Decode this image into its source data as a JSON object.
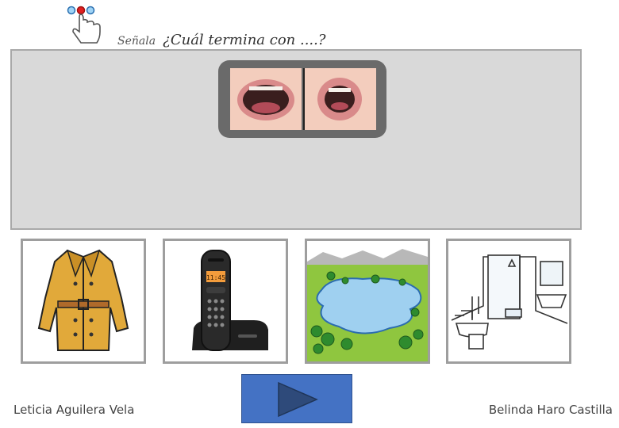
{
  "instruction": {
    "senala": "Señala",
    "question": "¿Cuál termina con ....?"
  },
  "stage": {
    "mouths": [
      "mouth-open-a",
      "mouth-rounded-o"
    ]
  },
  "cards": [
    {
      "name": "coat"
    },
    {
      "name": "cordless-phone"
    },
    {
      "name": "lake"
    },
    {
      "name": "bathroom"
    }
  ],
  "phone": {
    "display": "11:45"
  },
  "footer": {
    "author_left": "Leticia Aguilera Vela",
    "author_right": "Belinda Haro Castilla"
  },
  "colors": {
    "stage_bg": "#d9d9d9",
    "button": "#4472c4",
    "arrow": "#2e4a7a"
  }
}
